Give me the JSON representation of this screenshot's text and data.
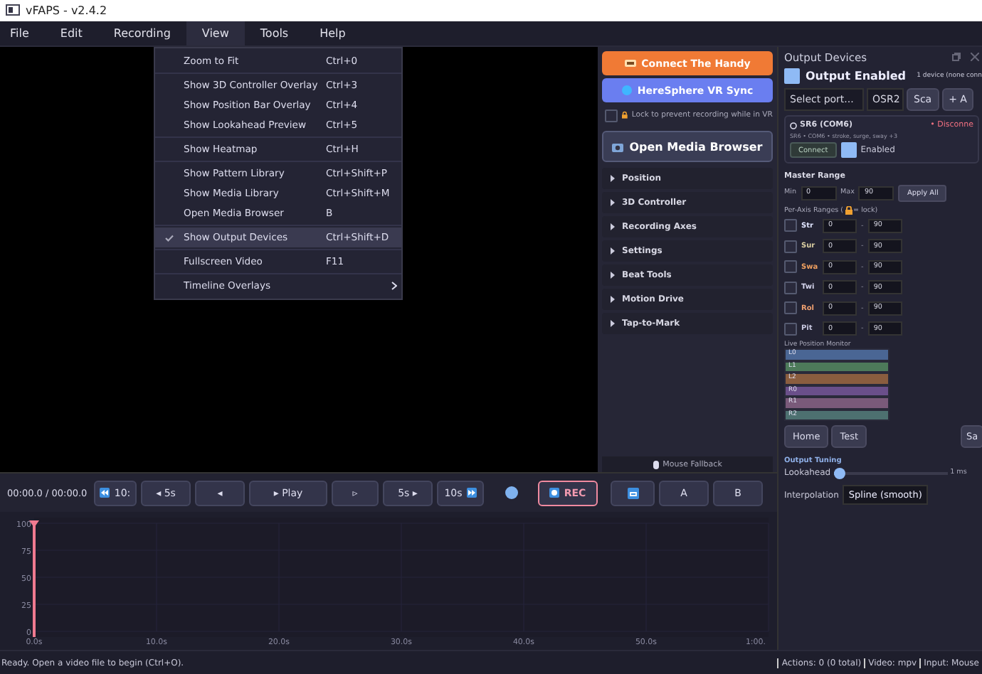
{
  "window": {
    "title": "vFAPS - v2.4.2"
  },
  "menubar": [
    {
      "label": "File",
      "selected": false
    },
    {
      "label": "Edit",
      "selected": false
    },
    {
      "label": "Recording",
      "selected": false
    },
    {
      "label": "View",
      "selected": true
    },
    {
      "label": "Tools",
      "selected": false
    },
    {
      "label": "Help",
      "selected": false
    }
  ],
  "view_menu": {
    "groups": [
      [
        {
          "label": "Zoom to Fit",
          "shortcut": "Ctrl+0",
          "checked": false,
          "highlighted": false
        }
      ],
      [
        {
          "label": "Show 3D Controller Overlay",
          "shortcut": "Ctrl+3",
          "checked": false,
          "highlighted": false
        },
        {
          "label": "Show Position Bar Overlay",
          "shortcut": "Ctrl+4",
          "checked": false,
          "highlighted": false
        },
        {
          "label": "Show Lookahead Preview",
          "shortcut": "Ctrl+5",
          "checked": false,
          "highlighted": false
        }
      ],
      [
        {
          "label": "Show Heatmap",
          "shortcut": "Ctrl+H",
          "checked": false,
          "highlighted": false
        }
      ],
      [
        {
          "label": "Show Pattern Library",
          "shortcut": "Ctrl+Shift+P",
          "checked": false,
          "highlighted": false
        },
        {
          "label": "Show Media Library",
          "shortcut": "Ctrl+Shift+M",
          "checked": false,
          "highlighted": false
        },
        {
          "label": "Open Media Browser",
          "shortcut": "B",
          "checked": false,
          "highlighted": false
        }
      ],
      [
        {
          "label": "Show Output Devices",
          "shortcut": "Ctrl+Shift+D",
          "checked": true,
          "highlighted": true
        }
      ],
      [
        {
          "label": "Fullscreen Video",
          "shortcut": "F11",
          "checked": false,
          "highlighted": false
        }
      ],
      [
        {
          "label": "Timeline Overlays",
          "submenu": true,
          "checked": false,
          "highlighted": false
        }
      ]
    ]
  },
  "side_panel": {
    "connect_button": "Connect The Handy",
    "vr_button": "HereSphere VR Sync",
    "lock": {
      "label": "Lock to prevent recording while in VR",
      "checked": false
    },
    "media_button": "Open Media Browser",
    "sections": [
      {
        "label": "Position",
        "expanded": false
      },
      {
        "label": "3D Controller",
        "expanded": false
      },
      {
        "label": "Recording Axes",
        "expanded": false
      },
      {
        "label": "Settings",
        "expanded": false
      },
      {
        "label": "Beat Tools",
        "expanded": false
      },
      {
        "label": "Motion Drive",
        "expanded": false
      },
      {
        "label": "Tap-to-Mark",
        "expanded": false
      }
    ],
    "mouse_fallback": "Mouse Fallback"
  },
  "transport": {
    "time": "00:00.0 / 00:00.0",
    "buttons": [
      {
        "kind": "skip_back",
        "label": "10:"
      },
      {
        "kind": "text",
        "label": "◂ 5s"
      },
      {
        "kind": "text",
        "label": "◂"
      },
      {
        "kind": "text",
        "label": "▸ Play"
      },
      {
        "kind": "text",
        "label": "▹"
      },
      {
        "kind": "text",
        "label": "5s ▸"
      },
      {
        "kind": "skip_forward",
        "label": "10s"
      },
      {
        "kind": "dot"
      },
      {
        "kind": "record",
        "label": "REC"
      },
      {
        "kind": "loop"
      },
      {
        "kind": "text",
        "label": "A"
      },
      {
        "kind": "text",
        "label": "B"
      }
    ]
  },
  "timeline": {
    "chart_data": {
      "type": "line",
      "grid": true,
      "xlim": [
        0,
        60
      ],
      "ylim": [
        0,
        100
      ],
      "yticks": [
        0,
        25,
        50,
        75,
        100
      ],
      "xticks": [
        {
          "value": 0,
          "label": "0.0s"
        },
        {
          "value": 10,
          "label": "10.0s"
        },
        {
          "value": 20,
          "label": "20.0s"
        },
        {
          "value": 30,
          "label": "30.0s"
        },
        {
          "value": 40,
          "label": "40.0s"
        },
        {
          "value": 50,
          "label": "50.0s"
        },
        {
          "value": 60,
          "label": "1:00."
        }
      ]
    }
  },
  "output_devices": {
    "title": "Output Devices",
    "enabled": {
      "label": "Output Enabled",
      "checked": true
    },
    "device_count": "1 device (none conn",
    "port_placeholder": "Select port...",
    "protocol": "OSR2",
    "scan_button": "Sca",
    "add_button": "+ A",
    "device": {
      "name": "SR6 (COM6)",
      "status": "• Disconne",
      "details": "SR6 • COM6 • stroke, surge, sway +3",
      "connect_button": "Connect",
      "enabled": {
        "label": "Enabled",
        "checked": true
      }
    },
    "master_range": {
      "title": "Master Range",
      "min_label": "Min",
      "min": "0",
      "max_label": "Max",
      "max": "90",
      "apply_button": "Apply All"
    },
    "per_axis": {
      "title_start": "Per-Axis Ranges (",
      "title_end": "= lock)",
      "axes": [
        {
          "name": "Str",
          "color": "#dfe4ff",
          "checked": false,
          "min": "0",
          "separator": "-",
          "max": "90"
        },
        {
          "name": "Sur",
          "color": "#d8cca0",
          "checked": false,
          "min": "0",
          "separator": "-",
          "max": "90"
        },
        {
          "name": "Swa",
          "color": "#f0a060",
          "checked": false,
          "min": "0",
          "separator": "-",
          "max": "90"
        },
        {
          "name": "Twi",
          "color": "#d4d4ec",
          "checked": false,
          "min": "0",
          "separator": "-",
          "max": "90"
        },
        {
          "name": "Rol",
          "color": "#f0a070",
          "checked": false,
          "min": "0",
          "separator": "-",
          "max": "90"
        },
        {
          "name": "Pit",
          "color": "#c8c8e0",
          "checked": false,
          "min": "0",
          "separator": "-",
          "max": "90"
        }
      ]
    },
    "monitor": {
      "title": "Live Position Monitor",
      "channels": [
        {
          "label": "L0",
          "color": "#4a6694"
        },
        {
          "label": "L1",
          "color": "#4d7a5a"
        },
        {
          "label": "L2",
          "color": "#8a5d3f"
        },
        {
          "label": "R0",
          "color": "#6a4f8a"
        },
        {
          "label": "R1",
          "color": "#7a5a7a"
        },
        {
          "label": "R2",
          "color": "#4d7070"
        }
      ]
    },
    "buttons": [
      "Home",
      "Test",
      "Sa"
    ],
    "tuning": {
      "title": "Output Tuning",
      "lookahead_label": "Lookahead",
      "lookahead": {
        "level": 0.05
      },
      "lookahead_value": "1 ms",
      "interpolation_label": "Interpolation",
      "interpolation": "Spline (smooth)"
    }
  },
  "status_bar": {
    "message": "Ready. Open a video file to begin (Ctrl+O).",
    "items": [
      "Actions: 0 (0 total)",
      "Video: mpv",
      "Input: Mouse"
    ]
  }
}
